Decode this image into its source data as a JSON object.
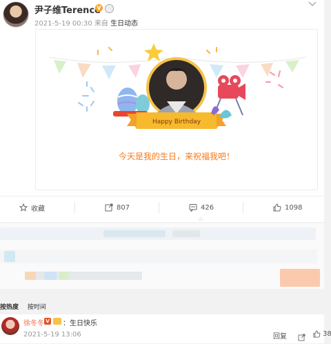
{
  "post": {
    "username": "尹子维Terence",
    "verified_badge": "V",
    "timestamp": "2021-5-19 00:30",
    "source_prefix": "来自",
    "source": "生日动态"
  },
  "card": {
    "banner_text": "Happy Birthday",
    "message": "今天是我的生日，来祝福我吧！"
  },
  "actions": {
    "favorite_label": "收藏",
    "repost_count": "807",
    "comment_count": "426",
    "like_count": "1098"
  },
  "comments": {
    "sort_hot": "按热度",
    "sort_time": "按时间",
    "item": {
      "name": "徐冬冬",
      "vip_badge": "V",
      "separator": "：",
      "text": "生日快乐",
      "time": "2021-5-19 13:06",
      "reply_label": "回复",
      "like_count": "38"
    }
  },
  "colors": {
    "accent_orange": "#f57a1c",
    "name_orange": "#eb7350",
    "badge_gold": "#f6a623"
  }
}
